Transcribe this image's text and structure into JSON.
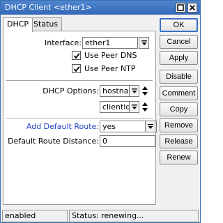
{
  "window": {
    "title": "DHCP Client <ether1>"
  },
  "tabs": [
    {
      "label": "DHCP",
      "active": true
    },
    {
      "label": "Status",
      "active": false
    }
  ],
  "form": {
    "interface_label": "Interface:",
    "interface_value": "ether1",
    "use_peer_dns_label": "Use Peer DNS",
    "use_peer_dns_checked": true,
    "use_peer_ntp_label": "Use Peer NTP",
    "use_peer_ntp_checked": true,
    "dhcp_options_label": "DHCP Options:",
    "dhcp_options": [
      "hostname",
      "clientid"
    ],
    "add_default_route_label": "Add Default Route:",
    "add_default_route_value": "yes",
    "default_route_distance_label": "Default Route Distance:",
    "default_route_distance_value": "0"
  },
  "buttons": {
    "ok": "OK",
    "cancel": "Cancel",
    "apply": "Apply",
    "disable": "Disable",
    "comment": "Comment",
    "copy": "Copy",
    "remove": "Remove",
    "release": "Release",
    "renew": "Renew"
  },
  "status": {
    "state": "enabled",
    "message": "Status: renewing..."
  },
  "colors": {
    "titlebar": "#3569b7",
    "highlight_label": "#1f3fbf"
  }
}
